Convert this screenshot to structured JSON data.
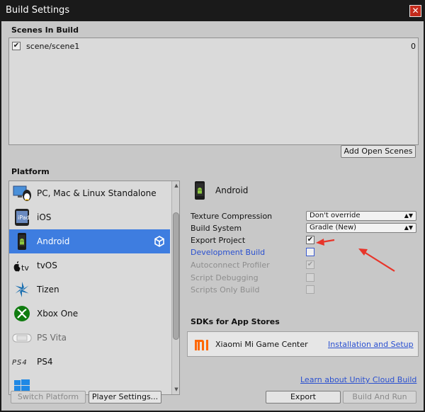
{
  "window": {
    "title": "Build Settings",
    "close_glyph": "✕"
  },
  "scenes": {
    "heading": "Scenes In Build",
    "items": [
      {
        "name": "scene/scene1",
        "index": "0",
        "checked": true
      }
    ],
    "add_button": "Add Open Scenes"
  },
  "platform": {
    "heading": "Platform",
    "items": [
      {
        "label": "PC, Mac & Linux Standalone",
        "icon": "pc-mac-linux-icon"
      },
      {
        "label": "iOS",
        "icon": "ios-icon"
      },
      {
        "label": "Android",
        "icon": "android-icon",
        "selected": true
      },
      {
        "label": "tvOS",
        "icon": "tvos-icon"
      },
      {
        "label": "Tizen",
        "icon": "tizen-icon"
      },
      {
        "label": "Xbox One",
        "icon": "xbox-icon"
      },
      {
        "label": "PS Vita",
        "icon": "ps-vita-icon"
      },
      {
        "label": "PS4",
        "icon": "ps4-icon"
      }
    ]
  },
  "settings": {
    "platform_name": "Android",
    "texture_compression": {
      "label": "Texture Compression",
      "value": "Don't override"
    },
    "build_system": {
      "label": "Build System",
      "value": "Gradle (New)"
    },
    "export_project": {
      "label": "Export Project",
      "checked": true
    },
    "development_build": {
      "label": "Development Build",
      "checked": false
    },
    "autoconnect_profiler": {
      "label": "Autoconnect Profiler",
      "checked": true,
      "disabled": true
    },
    "script_debugging": {
      "label": "Script Debugging",
      "checked": false,
      "disabled": true
    },
    "scripts_only_build": {
      "label": "Scripts Only Build",
      "checked": false,
      "disabled": true
    }
  },
  "sdks": {
    "heading": "SDKs for App Stores",
    "items": [
      {
        "name": "Xiaomi Mi Game Center",
        "logo": "mi",
        "link": "Installation and Setup"
      }
    ]
  },
  "cloud_link": "Learn about Unity Cloud Build",
  "buttons": {
    "switch_platform": "Switch Platform",
    "player_settings": "Player Settings...",
    "export": "Export",
    "build_and_run": "Build And Run"
  },
  "colors": {
    "selection": "#3e7de0",
    "link": "#2a50d0",
    "annotation_arrow": "#e8352a",
    "mi_logo": "#ff6700"
  }
}
